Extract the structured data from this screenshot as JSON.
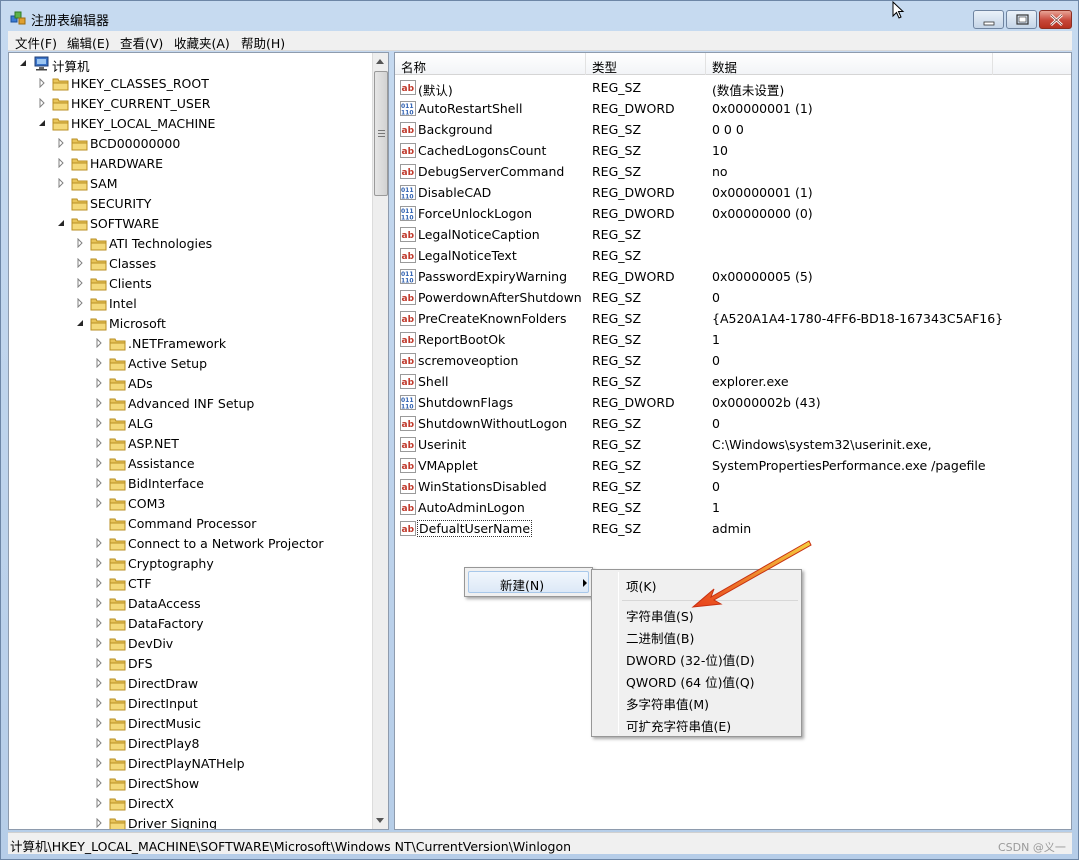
{
  "window": {
    "title": "注册表编辑器"
  },
  "menu": [
    "文件(F)",
    "编辑(E)",
    "查看(V)",
    "收藏夹(A)",
    "帮助(H)"
  ],
  "tree": {
    "root": "计算机",
    "nodes": [
      "HKEY_CLASSES_ROOT",
      "HKEY_CURRENT_USER",
      "HKEY_LOCAL_MACHINE",
      "BCD00000000",
      "HARDWARE",
      "SAM",
      "SECURITY",
      "SOFTWARE",
      "ATI Technologies",
      "Classes",
      "Clients",
      "Intel",
      "Microsoft",
      ".NETFramework",
      "Active Setup",
      "ADs",
      "Advanced INF Setup",
      "ALG",
      "ASP.NET",
      "Assistance",
      "BidInterface",
      "COM3",
      "Command Processor",
      "Connect to a Network Projector",
      "Cryptography",
      "CTF",
      "DataAccess",
      "DataFactory",
      "DevDiv",
      "DFS",
      "DirectDraw",
      "DirectInput",
      "DirectMusic",
      "DirectPlay8",
      "DirectPlayNATHelp",
      "DirectShow",
      "DirectX",
      "Driver Signing"
    ]
  },
  "list": {
    "headers": [
      "名称",
      "类型",
      "数据"
    ],
    "rows": [
      {
        "name": "(默认)",
        "type": "REG_SZ",
        "data": "(数值未设置)",
        "icon": "string-value-icon"
      },
      {
        "name": "AutoRestartShell",
        "type": "REG_DWORD",
        "data": "0x00000001 (1)",
        "icon": "binary-value-icon"
      },
      {
        "name": "Background",
        "type": "REG_SZ",
        "data": "0 0 0",
        "icon": "string-value-icon"
      },
      {
        "name": "CachedLogonsCount",
        "type": "REG_SZ",
        "data": "10",
        "icon": "string-value-icon"
      },
      {
        "name": "DebugServerCommand",
        "type": "REG_SZ",
        "data": "no",
        "icon": "string-value-icon"
      },
      {
        "name": "DisableCAD",
        "type": "REG_DWORD",
        "data": "0x00000001 (1)",
        "icon": "binary-value-icon"
      },
      {
        "name": "ForceUnlockLogon",
        "type": "REG_DWORD",
        "data": "0x00000000 (0)",
        "icon": "binary-value-icon"
      },
      {
        "name": "LegalNoticeCaption",
        "type": "REG_SZ",
        "data": "",
        "icon": "string-value-icon"
      },
      {
        "name": "LegalNoticeText",
        "type": "REG_SZ",
        "data": "",
        "icon": "string-value-icon"
      },
      {
        "name": "PasswordExpiryWarning",
        "type": "REG_DWORD",
        "data": "0x00000005 (5)",
        "icon": "binary-value-icon"
      },
      {
        "name": "PowerdownAfterShutdown",
        "type": "REG_SZ",
        "data": "0",
        "icon": "string-value-icon"
      },
      {
        "name": "PreCreateKnownFolders",
        "type": "REG_SZ",
        "data": "{A520A1A4-1780-4FF6-BD18-167343C5AF16}",
        "icon": "string-value-icon"
      },
      {
        "name": "ReportBootOk",
        "type": "REG_SZ",
        "data": "1",
        "icon": "string-value-icon"
      },
      {
        "name": "scremoveoption",
        "type": "REG_SZ",
        "data": "0",
        "icon": "string-value-icon"
      },
      {
        "name": "Shell",
        "type": "REG_SZ",
        "data": "explorer.exe",
        "icon": "string-value-icon"
      },
      {
        "name": "ShutdownFlags",
        "type": "REG_DWORD",
        "data": "0x0000002b (43)",
        "icon": "binary-value-icon"
      },
      {
        "name": "ShutdownWithoutLogon",
        "type": "REG_SZ",
        "data": "0",
        "icon": "string-value-icon"
      },
      {
        "name": "Userinit",
        "type": "REG_SZ",
        "data": "C:\\Windows\\system32\\userinit.exe,",
        "icon": "string-value-icon"
      },
      {
        "name": "VMApplet",
        "type": "REG_SZ",
        "data": "SystemPropertiesPerformance.exe /pagefile",
        "icon": "string-value-icon"
      },
      {
        "name": "WinStationsDisabled",
        "type": "REG_SZ",
        "data": "0",
        "icon": "string-value-icon"
      },
      {
        "name": "AutoAdminLogon",
        "type": "REG_SZ",
        "data": "1",
        "icon": "string-value-icon"
      },
      {
        "name": "DefualtUserName",
        "type": "REG_SZ",
        "data": "admin",
        "icon": "string-value-icon"
      }
    ]
  },
  "context_menu": {
    "new_label": "新建(N)",
    "submenu": [
      "项(K)",
      "字符串值(S)",
      "二进制值(B)",
      "DWORD (32-位)值(D)",
      "QWORD (64 位)值(Q)",
      "多字符串值(M)",
      "可扩充字符串值(E)"
    ]
  },
  "status": "计算机\\HKEY_LOCAL_MACHINE\\SOFTWARE\\Microsoft\\Windows NT\\CurrentVersion\\Winlogon",
  "watermark": "CSDN @义一",
  "colors": {
    "folder": "#e8c45a",
    "string_icon": "#c0392b",
    "binary_icon": "#2d5fb0",
    "annotation_arrow": "#f0a020"
  }
}
